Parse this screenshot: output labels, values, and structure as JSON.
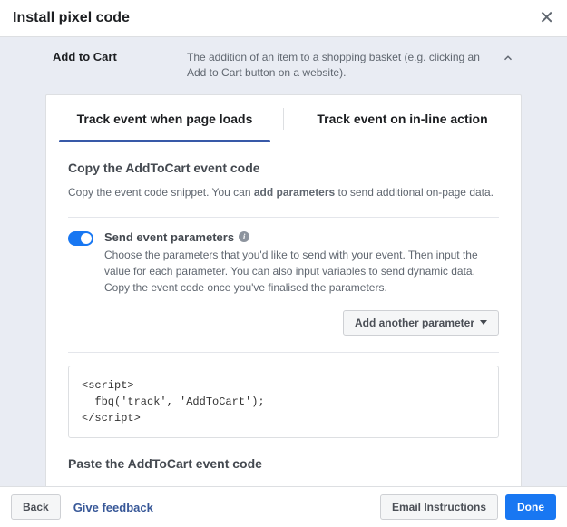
{
  "header": {
    "title": "Install pixel code"
  },
  "event": {
    "name": "Add to Cart",
    "description": "The addition of an item to a shopping basket (e.g. clicking an Add to Cart button on a website)."
  },
  "tabs": {
    "page_load": "Track event when page loads",
    "inline": "Track event on in-line action"
  },
  "copy_section": {
    "title": "Copy the AddToCart event code",
    "desc_pre": "Copy the event code snippet. You can ",
    "desc_bold": "add parameters",
    "desc_post": " to send additional on-page data."
  },
  "params": {
    "label": "Send event parameters",
    "desc": "Choose the parameters that you'd like to send with your event. Then input the value for each parameter. You can also input variables to send dynamic data. Copy the event code once you've finalised the parameters.",
    "add_btn": "Add another parameter"
  },
  "code": "<script>\n  fbq('track', 'AddToCart');\n</scr",
  "code_suffix": "ipt>",
  "paste_section": {
    "title": "Paste the AddToCart event code"
  },
  "footer": {
    "back": "Back",
    "feedback": "Give feedback",
    "email": "Email Instructions",
    "done": "Done"
  }
}
